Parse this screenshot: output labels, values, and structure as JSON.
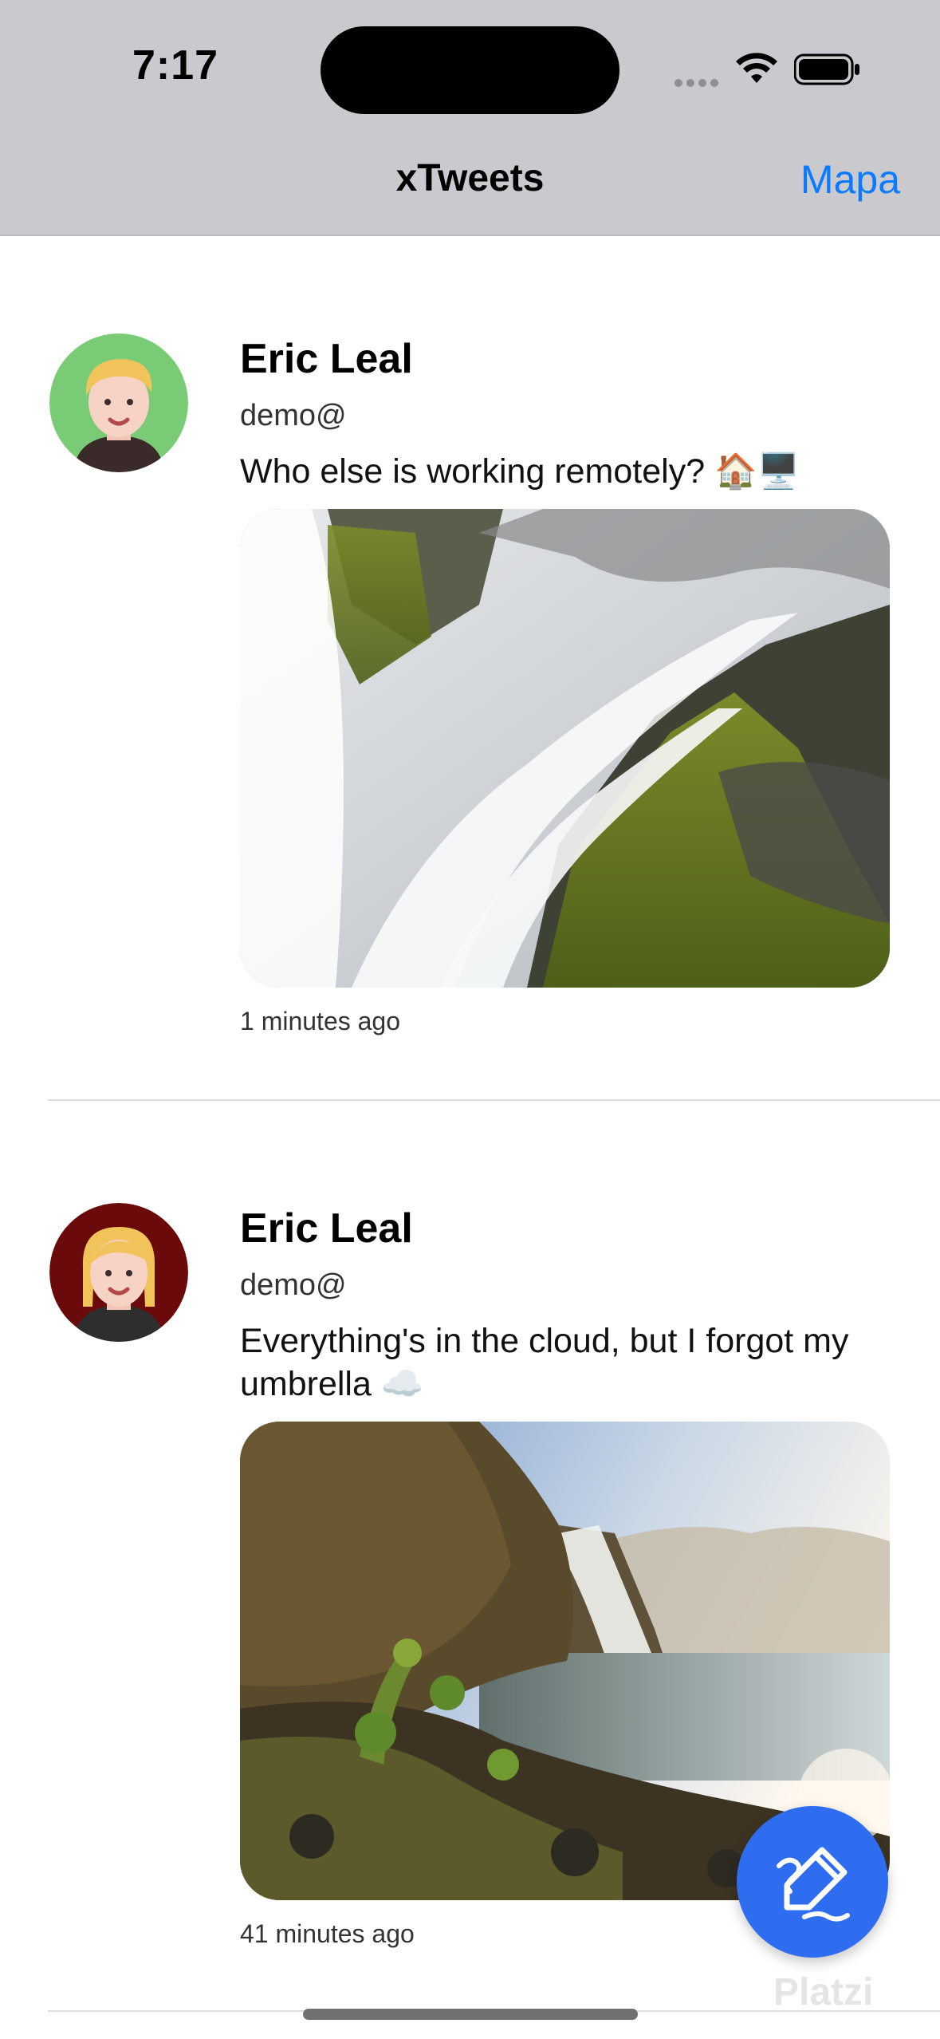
{
  "status_bar": {
    "time": "7:17"
  },
  "nav": {
    "title": "xTweets",
    "action_label": "Mapa"
  },
  "tweets": [
    {
      "name": "Eric Leal",
      "handle": "demo@",
      "text": "Who else is working remotely? 🏠🖥️",
      "time": "1 minutes ago",
      "avatar_bg": "#7acb75",
      "image": "waterfall-closeup"
    },
    {
      "name": "Eric Leal",
      "handle": "demo@",
      "text": "Everything's in the cloud, but I forgot my umbrella ☁️",
      "time": "41 minutes ago",
      "avatar_bg": "#6b0a0a",
      "image": "waterfall-landscape"
    }
  ],
  "fab": {
    "icon": "compose-pencil-icon",
    "color": "#2f6df0"
  },
  "watermark": "Platzi",
  "colors": {
    "accent": "#0a7aff",
    "nav_bg": "#c9c9ce"
  }
}
